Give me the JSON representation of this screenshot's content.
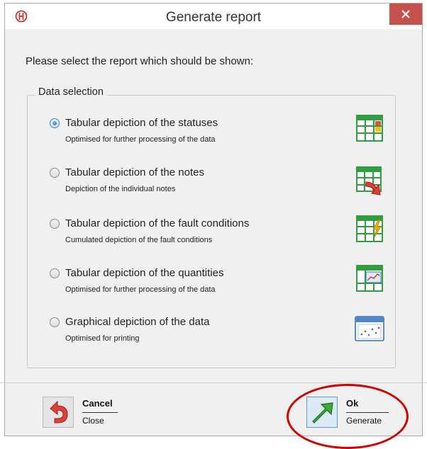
{
  "dialog": {
    "title": "Generate report",
    "logo_icon": "company-logo-icon",
    "close_icon": "close-icon"
  },
  "prompt": "Please select the report which should be shown:",
  "group": {
    "legend": "Data selection",
    "selected_index": 0,
    "options": [
      {
        "label": "Tabular depiction of the statuses",
        "description": "Optimised for further processing of the data",
        "icon": "table-statuses-icon"
      },
      {
        "label": "Tabular depiction of the notes",
        "description": "Depiction of the individual notes",
        "icon": "table-notes-icon"
      },
      {
        "label": "Tabular depiction of the fault conditions",
        "description": "Cumulated depiction of the fault conditions",
        "icon": "table-fault-icon"
      },
      {
        "label": "Tabular depiction of the quantities",
        "description": "Optimised for further processing of the data",
        "icon": "table-quantities-icon"
      },
      {
        "label": "Graphical depiction of the data",
        "description": "Optimised for printing",
        "icon": "chart-window-icon"
      }
    ]
  },
  "buttons": {
    "cancel": {
      "label": "Cancel",
      "description": "Close",
      "icon": "undo-arrow-icon"
    },
    "ok": {
      "label": "Ok",
      "description": "Generate",
      "icon": "green-arrow-icon"
    }
  },
  "colors": {
    "close_button": "#c7504a",
    "highlight_ring": "#d00000",
    "table_green": "#2e9e3e"
  }
}
